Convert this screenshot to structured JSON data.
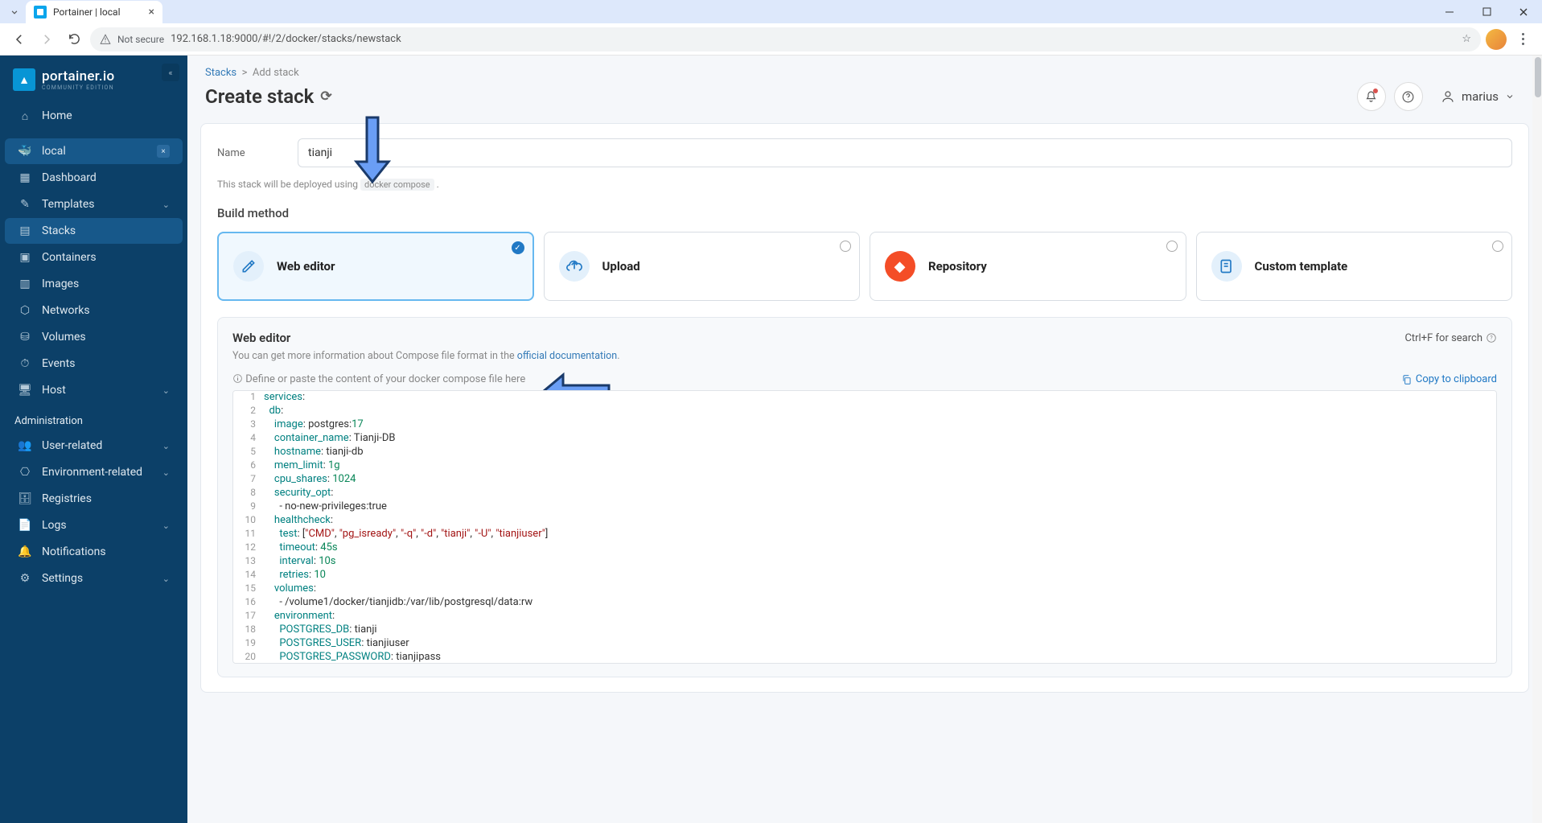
{
  "browser": {
    "tab_title": "Portainer | local",
    "not_secure": "Not secure",
    "url": "192.168.1.18:9000/#!/2/docker/stacks/newstack"
  },
  "sidebar": {
    "logo_title": "portainer.io",
    "logo_sub": "COMMUNITY EDITION",
    "home": "Home",
    "env": "local",
    "items": [
      "Dashboard",
      "Templates",
      "Stacks",
      "Containers",
      "Images",
      "Networks",
      "Volumes",
      "Events",
      "Host"
    ],
    "admin_header": "Administration",
    "admin_items": [
      "User-related",
      "Environment-related",
      "Registries",
      "Logs",
      "Notifications",
      "Settings"
    ]
  },
  "breadcrumb": {
    "root": "Stacks",
    "sep": ">",
    "current": "Add stack"
  },
  "page_title": "Create stack",
  "user": "marius",
  "form": {
    "name_label": "Name",
    "name_value": "tianji",
    "hint_pre": "This stack will be deployed using ",
    "hint_code": "docker compose",
    "hint_post": " ."
  },
  "build": {
    "title": "Build method",
    "methods": [
      "Web editor",
      "Upload",
      "Repository",
      "Custom template"
    ]
  },
  "editor": {
    "title": "Web editor",
    "search": "Ctrl+F for search",
    "desc_pre": "You can get more information about Compose file format in the ",
    "desc_link": "official documentation",
    "desc_post": ".",
    "placeholder": "Define or paste the content of your docker compose file here",
    "copy": "Copy to clipboard"
  },
  "code": [
    {
      "n": 1,
      "ind": 0,
      "key": "services",
      "sep": ":",
      "rest": ""
    },
    {
      "n": 2,
      "ind": 2,
      "key": "db",
      "sep": ":",
      "rest": ""
    },
    {
      "n": 3,
      "ind": 4,
      "key": "image",
      "sep": ": ",
      "val": "postgres:",
      "num": "17"
    },
    {
      "n": 4,
      "ind": 4,
      "key": "container_name",
      "sep": ": ",
      "rest": "Tianji-DB"
    },
    {
      "n": 5,
      "ind": 4,
      "key": "hostname",
      "sep": ": ",
      "rest": "tianji-db"
    },
    {
      "n": 6,
      "ind": 4,
      "key": "mem_limit",
      "sep": ": ",
      "num": "1g"
    },
    {
      "n": 7,
      "ind": 4,
      "key": "cpu_shares",
      "sep": ": ",
      "num": "1024"
    },
    {
      "n": 8,
      "ind": 4,
      "key": "security_opt",
      "sep": ":",
      "rest": ""
    },
    {
      "n": 9,
      "ind": 6,
      "dash": true,
      "rest": "no-new-privileges:true"
    },
    {
      "n": 10,
      "ind": 4,
      "key": "healthcheck",
      "sep": ":",
      "rest": ""
    },
    {
      "n": 11,
      "ind": 6,
      "key": "test",
      "sep": ": ",
      "arr": [
        "\"CMD\"",
        "\"pg_isready\"",
        "\"-q\"",
        "\"-d\"",
        "\"tianji\"",
        "\"-U\"",
        "\"tianjiuser\""
      ]
    },
    {
      "n": 12,
      "ind": 6,
      "key": "timeout",
      "sep": ": ",
      "num": "45s"
    },
    {
      "n": 13,
      "ind": 6,
      "key": "interval",
      "sep": ": ",
      "num": "10s"
    },
    {
      "n": 14,
      "ind": 6,
      "key": "retries",
      "sep": ": ",
      "num": "10"
    },
    {
      "n": 15,
      "ind": 4,
      "key": "volumes",
      "sep": ":",
      "rest": ""
    },
    {
      "n": 16,
      "ind": 6,
      "dash": true,
      "rest": "/volume1/docker/tianjidb:/var/lib/postgresql/data:rw"
    },
    {
      "n": 17,
      "ind": 4,
      "key": "environment",
      "sep": ":",
      "rest": ""
    },
    {
      "n": 18,
      "ind": 6,
      "key": "POSTGRES_DB",
      "sep": ": ",
      "rest": "tianji"
    },
    {
      "n": 19,
      "ind": 6,
      "key": "POSTGRES_USER",
      "sep": ": ",
      "rest": "tianjiuser"
    },
    {
      "n": 20,
      "ind": 6,
      "key": "POSTGRES_PASSWORD",
      "sep": ": ",
      "rest": "tianjipass"
    }
  ],
  "icons": {
    "home": "⌂",
    "dashboard": "▦",
    "templates": "✎",
    "stacks": "▤",
    "containers": "▣",
    "images": "▥",
    "networks": "⬡",
    "volumes": "⛁",
    "events": "⏱",
    "host": "🖥",
    "users": "👥",
    "env": "⎔",
    "registries": "🗄",
    "logs": "📄",
    "notif": "🔔",
    "settings": "⚙"
  }
}
